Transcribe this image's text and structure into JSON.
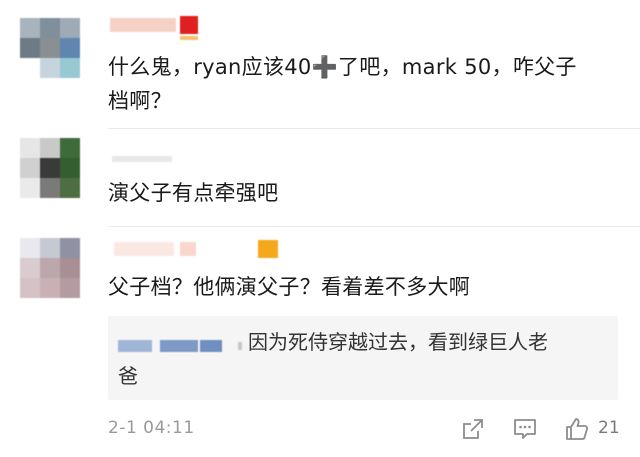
{
  "comments": [
    {
      "text_line1": "什么鬼，ryan应该40➕了吧，mark 50，咋父子",
      "text_line2": "档啊？"
    },
    {
      "text_line1": "演父子有点牵强吧"
    },
    {
      "text_line1": "父子档？他俩演父子？看着差不多大啊"
    }
  ],
  "reply": {
    "text_line1": "因为死侍穿越过去，看到绿巨人老",
    "text_line2": "爸"
  },
  "footer": {
    "time": "2-1 04:11",
    "likes": "21",
    "share_icon": "share-icon",
    "comment_icon": "comment-icon",
    "like_icon": "thumbs-up-icon"
  },
  "colors": {
    "badge_red": "#e02020",
    "badge_orange": "#f6a81c",
    "reply_bg": "#f5f5f5",
    "meta_gray": "#9a9a9a"
  }
}
